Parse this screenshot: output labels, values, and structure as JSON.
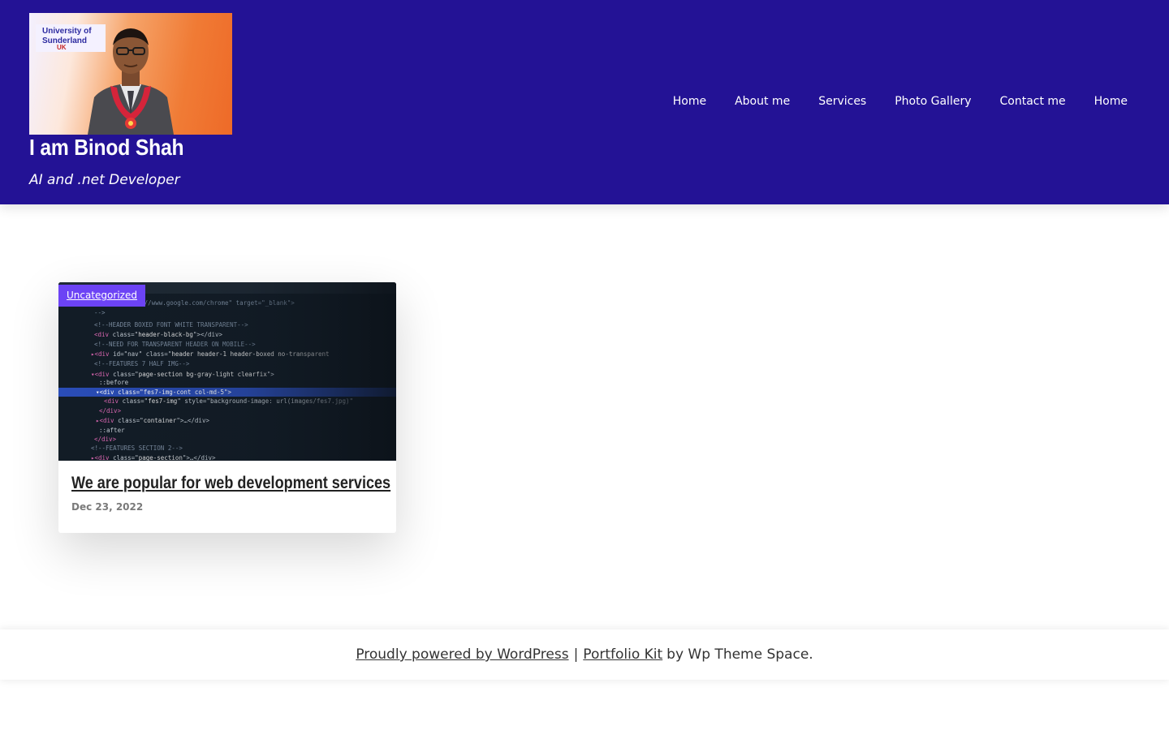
{
  "header": {
    "site_title": "I am Binod Shah",
    "tagline": "AI and .net Developer",
    "logo_banner_line1": "University of",
    "logo_banner_line2": "Sunderland",
    "logo_banner_line3": "UK",
    "background_color": "#231295"
  },
  "nav": {
    "items": [
      {
        "label": "Home"
      },
      {
        "label": "About me"
      },
      {
        "label": "Services"
      },
      {
        "label": "Photo Gallery"
      },
      {
        "label": "Contact me"
      },
      {
        "label": "Home"
      }
    ]
  },
  "post": {
    "category": "Uncategorized",
    "title": "We are popular for web development services",
    "date": "Dec 23, 2022",
    "badge_color": "#6c43f5"
  },
  "footer": {
    "powered_link": "Proudly powered by WordPress",
    "separator": "|",
    "theme_link": "Portfolio Kit",
    "by_text": "by Wp Theme Space."
  }
}
